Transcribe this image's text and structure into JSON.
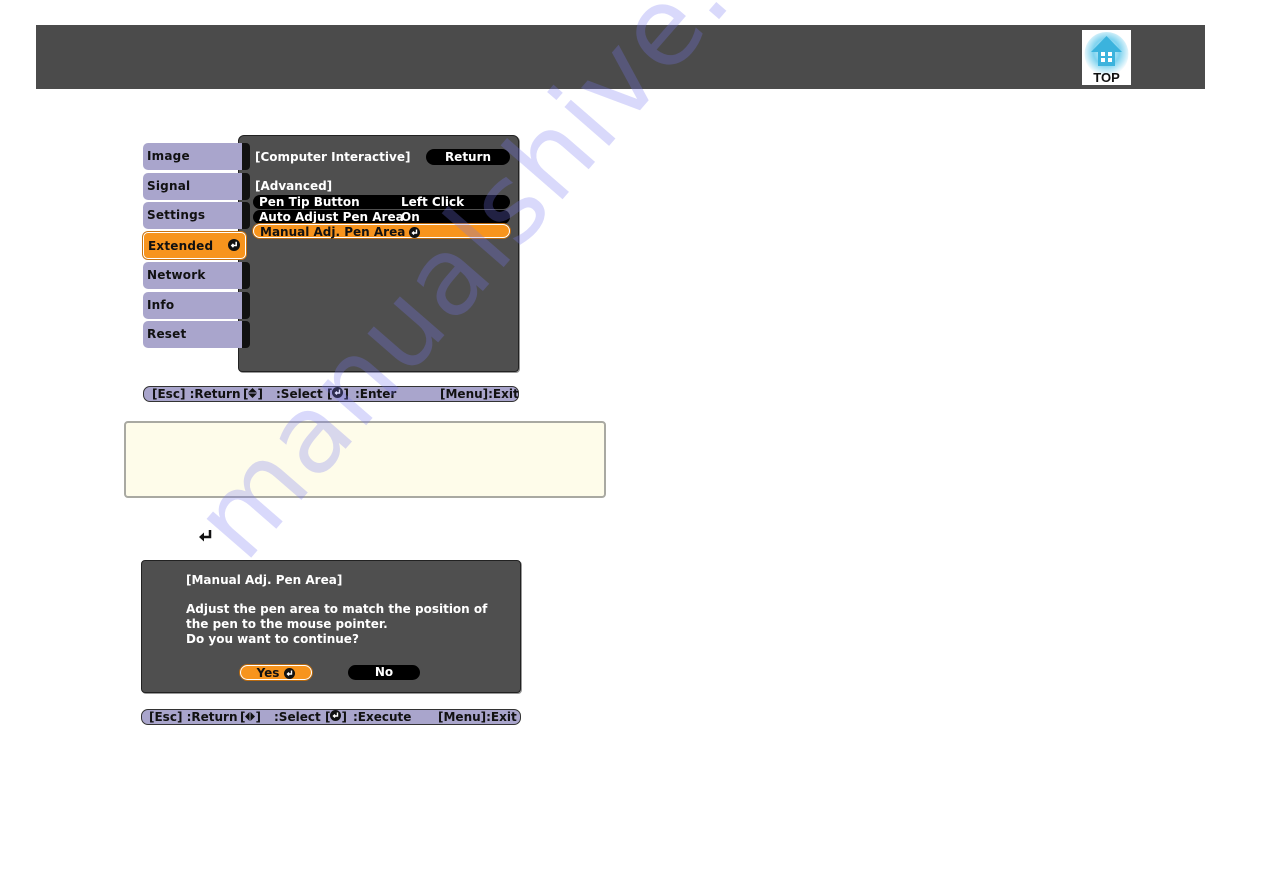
{
  "header": {
    "top_link_label": "TOP",
    "top_link_icon": "home-arrow-up-icon"
  },
  "menu_screen": {
    "tabs": [
      {
        "label": "Image",
        "active": false
      },
      {
        "label": "Signal",
        "active": false
      },
      {
        "label": "Settings",
        "active": false
      },
      {
        "label": "Extended",
        "active": true
      },
      {
        "label": "Network",
        "active": false
      },
      {
        "label": "Info",
        "active": false
      },
      {
        "label": "Reset",
        "active": false
      }
    ],
    "panel_title": "[Computer Interactive]",
    "return_label": "Return",
    "section_label": "[Advanced]",
    "rows": [
      {
        "label": "Pen Tip Button",
        "value": "Left Click",
        "selected": false
      },
      {
        "label": "Auto Adjust Pen Area",
        "value": "On",
        "selected": false
      },
      {
        "label": "Manual Adj. Pen Area",
        "value": "",
        "selected": true
      }
    ],
    "help_bar": {
      "esc": "[Esc] :Return",
      "select": ":Select",
      "enter": ":Enter",
      "menu": "[Menu]:Exit"
    }
  },
  "note_box": {
    "text": ""
  },
  "inline_icon": "enter-key-icon",
  "dialog_screen": {
    "title": "[Manual Adj. Pen Area]",
    "message_lines": [
      "Adjust the pen area to match the position of",
      "the pen to the mouse pointer.",
      "Do you want to continue?"
    ],
    "yes_label": "Yes",
    "no_label": "No",
    "help_bar": {
      "esc": "[Esc] :Return",
      "select": ":Select",
      "execute": ":Execute",
      "menu": "[Menu]:Exit"
    }
  },
  "watermark": "manualshive.com",
  "colors": {
    "header_bg": "#4b4b4b",
    "tab_bg": "#a9a5cc",
    "highlight": "#f7941d",
    "panel_bg": "#4f4f4f",
    "note_bg": "#fefcea"
  }
}
